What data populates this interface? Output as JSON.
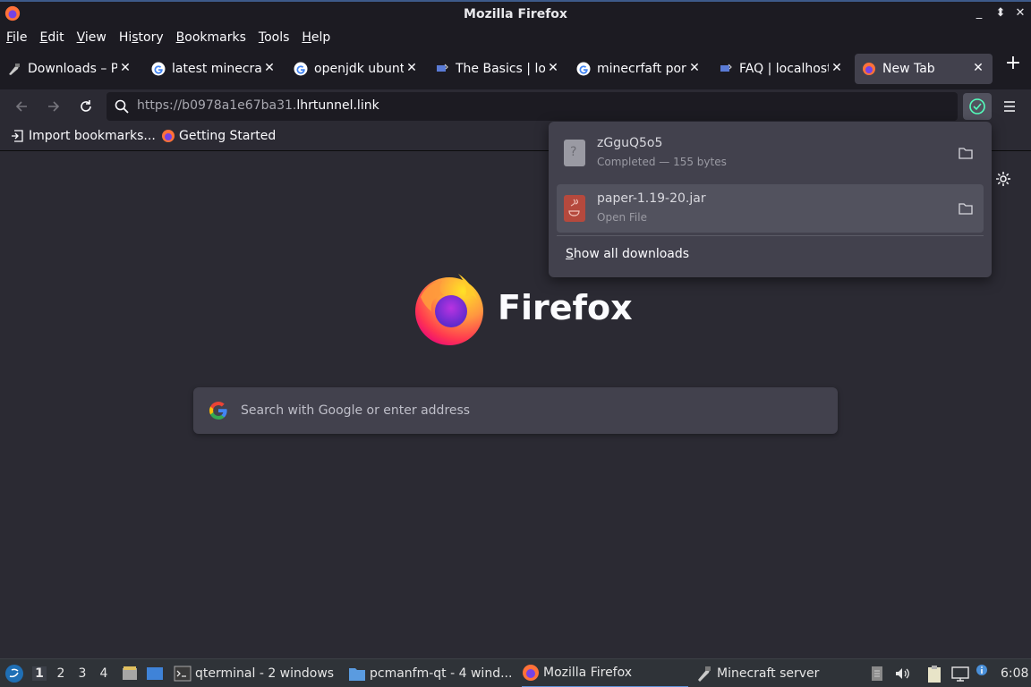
{
  "window": {
    "title": "Mozilla Firefox"
  },
  "window_controls": {
    "minimize": "_",
    "restore": "⬍",
    "close": "✕"
  },
  "menubar": [
    {
      "label": "File",
      "accel": "F",
      "rest": "ile"
    },
    {
      "label": "Edit",
      "accel": "E",
      "rest": "dit"
    },
    {
      "label": "View",
      "accel": "V",
      "rest": "iew"
    },
    {
      "label": "History",
      "accel": "s",
      "pre": "Hi",
      "rest": "tory"
    },
    {
      "label": "Bookmarks",
      "accel": "B",
      "rest": "ookmarks"
    },
    {
      "label": "Tools",
      "accel": "T",
      "rest": "ools"
    },
    {
      "label": "Help",
      "accel": "H",
      "rest": "elp"
    }
  ],
  "tabs": [
    {
      "label": "Downloads – Pa",
      "icon": "minecraft-icon",
      "active": false
    },
    {
      "label": "latest minecraf",
      "icon": "google-icon",
      "active": false
    },
    {
      "label": "openjdk ubuntu",
      "icon": "google-icon",
      "active": false
    },
    {
      "label": "The Basics | loc",
      "icon": "localhost-icon",
      "active": false
    },
    {
      "label": "minecrfaft port",
      "icon": "google-icon",
      "active": false
    },
    {
      "label": "FAQ | localhost.",
      "icon": "localhost-icon",
      "active": false
    },
    {
      "label": "New Tab",
      "icon": "firefox-icon",
      "active": true
    }
  ],
  "tab_close_glyph": "✕",
  "new_tab_glyph": "+",
  "navbar": {
    "url_dim": "https://b0978a1e67ba31.",
    "url_main": "lhrtunnel.link"
  },
  "bookmarks": [
    {
      "label": "Import bookmarks...",
      "icon": "import-icon"
    },
    {
      "label": "Getting Started",
      "icon": "firefox-icon"
    }
  ],
  "newtab": {
    "wordmark": "Firefox",
    "search_placeholder": "Search with Google or enter address"
  },
  "downloads": {
    "items": [
      {
        "name": "zGguQ5o5",
        "status": "Completed — 155 bytes",
        "type": "unknown-file-icon"
      },
      {
        "name": "paper-1.19-20.jar",
        "status": "Open File",
        "type": "java-file-icon"
      }
    ],
    "show_all": "Show all downloads"
  },
  "taskbar": {
    "workspaces": [
      "1",
      "2",
      "3",
      "4"
    ],
    "current_workspace": "1",
    "windows": [
      {
        "label": "qterminal - 2 windows",
        "icon": "terminal-icon"
      },
      {
        "label": "pcmanfm-qt - 4 wind...",
        "icon": "folder-icon"
      },
      {
        "label": "Mozilla Firefox",
        "icon": "firefox-icon",
        "active": true
      },
      {
        "label": "Minecraft server",
        "icon": "minecraft-icon"
      }
    ],
    "clock": "6:08"
  },
  "colors": {
    "accent": "#5b8fd6",
    "panel": "#42414d",
    "background": "#2b2a33",
    "chrome": "#1c1b22"
  }
}
